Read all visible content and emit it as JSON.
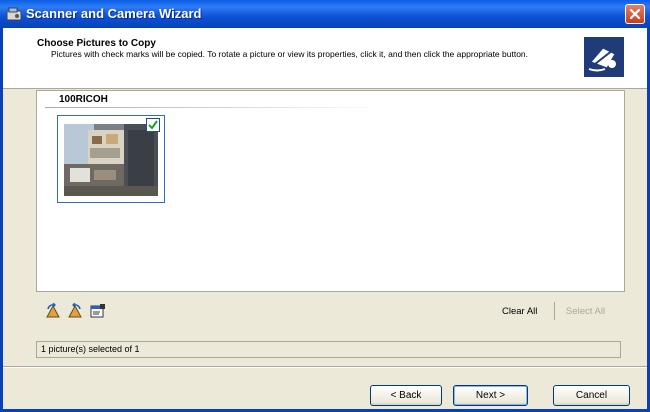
{
  "window": {
    "title": "Scanner and Camera Wizard"
  },
  "header": {
    "title": "Choose Pictures to Copy",
    "description": "Pictures with check marks will be copied. To rotate a picture or view its properties, click it, and then click the appropriate button."
  },
  "folder": {
    "label": "100RICOH",
    "items": [
      {
        "checked": true,
        "selected": true
      }
    ]
  },
  "toolbar": {
    "icons": [
      "rotate-clockwise-icon",
      "rotate-counterclockwise-icon",
      "properties-icon"
    ],
    "clear_all": "Clear All",
    "select_all": "Select All"
  },
  "status": {
    "text": "1 picture(s) selected of 1"
  },
  "buttons": {
    "back": "< Back",
    "next": "Next >",
    "cancel": "Cancel"
  },
  "colors": {
    "titlebar": "#0b52d6",
    "window_bg": "#ece9d8",
    "selection": "#316ac5",
    "disabled_text": "#aca899"
  }
}
